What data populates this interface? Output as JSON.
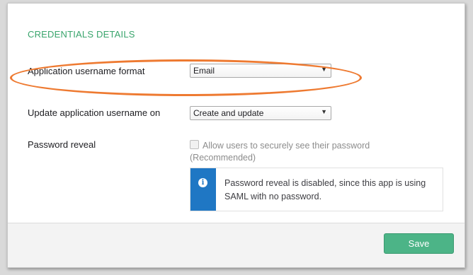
{
  "section": {
    "title": "CREDENTIALS DETAILS"
  },
  "fields": {
    "username_format": {
      "label": "Application username format",
      "value": "Email"
    },
    "update_on": {
      "label": "Update application username on",
      "value": "Create and update"
    },
    "password_reveal": {
      "label": "Password reveal",
      "checkbox_label": "Allow users to securely see their password (Recommended)",
      "checked": false
    }
  },
  "info": {
    "icon": "info-icon",
    "text": "Password reveal is disabled, since this app is using SAML with no password."
  },
  "footer": {
    "save_label": "Save"
  },
  "colors": {
    "section_title": "#3aa56d",
    "info_bar": "#1f77c4",
    "save_button": "#4cb487",
    "highlight": "#ee7a31"
  }
}
